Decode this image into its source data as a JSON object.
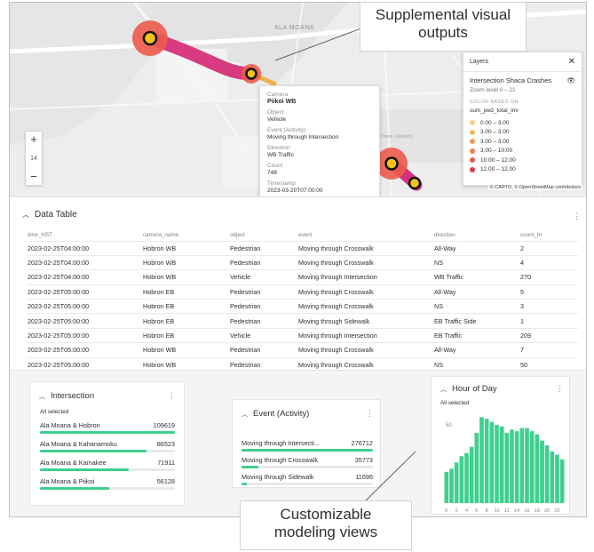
{
  "map": {
    "street_label": "ALA MOANA",
    "zoom_in": "+",
    "zoom_out": "−",
    "zoom_level": "14",
    "attribution": "© CARTO, © OpenStreetMap contributors",
    "faint_label": "Town (Outlet)"
  },
  "tooltip": {
    "camera_key": "Camera",
    "camera_val": "Piikoi WB",
    "object_key": "Object",
    "object_val": "Vehicle",
    "event_key": "Event (Activity)",
    "event_val": "Moving through Intersection",
    "direction_key": "Direction",
    "direction_val": "WB Traffic",
    "count_key": "Count",
    "count_val": "748",
    "timestamp_key": "Timestamp",
    "timestamp_val": "2023-03-20T07:00:00"
  },
  "layers": {
    "title": "Layers",
    "layer_name": "Intersection Shaca Crashes",
    "zoom_range": "Zoom level 0 – 21",
    "color_based_on": "COLOR BASED ON",
    "field": "sum_ped_total_inv",
    "legend": [
      {
        "label": "0.00 – 3.00",
        "color": "#f6d38a"
      },
      {
        "label": "3.00 – 3.00",
        "color": "#f2b86b"
      },
      {
        "label": "3.00 – 3.00",
        "color": "#ef9d58"
      },
      {
        "label": "3.00 – 10.00",
        "color": "#ec7f4b"
      },
      {
        "label": "10.00 – 12.00",
        "color": "#e85f48"
      },
      {
        "label": "12.00 – 12.00",
        "color": "#d93e4a"
      }
    ]
  },
  "table": {
    "title": "Data Table",
    "columns": [
      "time_HST",
      "camera_name",
      "object",
      "event",
      "direction",
      "count_hr"
    ],
    "rows": [
      [
        "2023-02-25T04:00:00",
        "Hobron WB",
        "Pedestrian",
        "Moving through Crosswalk",
        "All-Way",
        "2"
      ],
      [
        "2023-02-25T04:00:00",
        "Hobron WB",
        "Pedestrian",
        "Moving through Crosswalk",
        "NS",
        "4"
      ],
      [
        "2023-02-25T04:00:00",
        "Hobron WB",
        "Vehicle",
        "Moving through Intersection",
        "WB Traffic",
        "270"
      ],
      [
        "2023-02-25T05:00:00",
        "Hobron EB",
        "Pedestrian",
        "Moving through Crosswalk",
        "All-Way",
        "5"
      ],
      [
        "2023-02-25T05:00:00",
        "Hobron EB",
        "Pedestrian",
        "Moving through Crosswalk",
        "NS",
        "3"
      ],
      [
        "2023-02-25T05:00:00",
        "Hobron EB",
        "Pedestrian",
        "Moving through Sidewalk",
        "EB Traffic Side",
        "1"
      ],
      [
        "2023-02-25T05:00:00",
        "Hobron EB",
        "Vehicle",
        "Moving through Intersection",
        "EB Traffic",
        "209"
      ],
      [
        "2023-02-25T05:00:00",
        "Hobron WB",
        "Pedestrian",
        "Moving through Crosswalk",
        "All-Way",
        "7"
      ],
      [
        "2023-02-25T05:00:00",
        "Hobron WB",
        "Pedestrian",
        "Moving through Crosswalk",
        "NS",
        "50"
      ]
    ]
  },
  "intersection": {
    "title": "Intersection",
    "all_selected": "All selected",
    "items": [
      {
        "label": "Ala Moana & Hobron",
        "value": "109619",
        "fraction": 1.0
      },
      {
        "label": "Ala Moana & Kahanamoku",
        "value": "86523",
        "fraction": 0.79
      },
      {
        "label": "Ala Moana & Kamakee",
        "value": "71911",
        "fraction": 0.66
      },
      {
        "label": "Ala Moana & Piikoi",
        "value": "56128",
        "fraction": 0.51
      }
    ]
  },
  "event": {
    "title": "Event (Activity)",
    "items": [
      {
        "label": "Moving through Intersecti...",
        "value": "276712",
        "fraction": 1.0
      },
      {
        "label": "Moving through Crosswalk",
        "value": "35773",
        "fraction": 0.13
      },
      {
        "label": "Moving through Sidewalk",
        "value": "11696",
        "fraction": 0.04
      }
    ]
  },
  "hour_of_day": {
    "title": "Hour of Day",
    "all_selected": "All selected"
  },
  "chart_data": {
    "type": "bar",
    "title": "Hour of Day",
    "x": [
      0,
      1,
      2,
      3,
      4,
      5,
      6,
      7,
      8,
      9,
      10,
      11,
      12,
      13,
      14,
      15,
      16,
      17,
      18,
      19,
      20,
      21,
      22,
      23
    ],
    "values": [
      20,
      22,
      26,
      30,
      32,
      36,
      45,
      55,
      54,
      52,
      50,
      49,
      45,
      47,
      46,
      48,
      48,
      46,
      44,
      40,
      37,
      33,
      31,
      28
    ],
    "ylim": [
      0,
      58
    ],
    "y_tick_label": "50",
    "xtick_labels": [
      "0",
      "2",
      "4",
      "6",
      "8",
      "10",
      "12",
      "14",
      "16",
      "18",
      "20",
      "22"
    ],
    "grid": false,
    "color": "#3ecf8e"
  },
  "callouts": {
    "top": "Supplemental visual outputs",
    "bottom": "Customizable modeling views"
  },
  "colors": {
    "accent_green": "#3ecf8e",
    "crash_red": "#ec5a4b",
    "route_magenta": "#d6307a",
    "dot_yellow": "#f4c21a"
  }
}
